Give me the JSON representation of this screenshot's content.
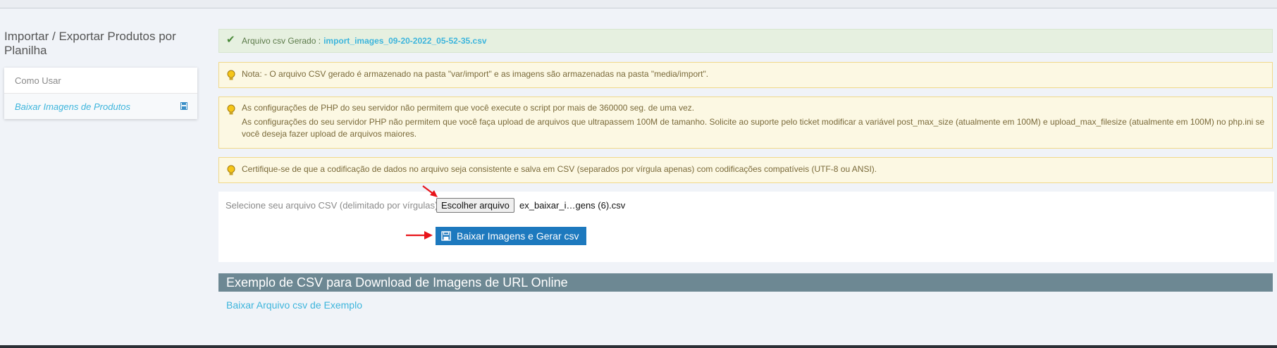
{
  "page": {
    "title": "Importar / Exportar Produtos por Planilha"
  },
  "sidebar": {
    "items": [
      {
        "label": "Como Usar",
        "active": false
      },
      {
        "label": "Baixar Imagens de Produtos",
        "active": true,
        "icon": "save-icon"
      }
    ]
  },
  "alerts": {
    "success": {
      "prefix": "Arquivo csv Gerado :",
      "filename": "import_images_09-20-2022_05-52-35.csv",
      "icon": "check-icon"
    },
    "note": "Nota: - O arquivo CSV gerado é armazenado na pasta \"var/import\" e as imagens são armazenadas na pasta \"media/import\".",
    "php_time": "As configurações de PHP do seu servidor não permitem que você execute o script por mais de 360000 seg. de uma vez.",
    "php_upload": "As configurações do seu servidor PHP não permitem que você faça upload de arquivos que ultrapassem 100M de tamanho. Solicite ao suporte pelo ticket modificar a variável post_max_size (atualmente em 100M) e upload_max_filesize (atualmente em 100M) no php.ini se você deseja fazer upload de arquivos maiores.",
    "encoding": "Certifique-se de que a codificação de dados no arquivo seja consistente e salva em CSV (separados por vírgula apenas) com codificações compatíveis (UTF-8 ou ANSI).",
    "warn_icon": "lightbulb-icon"
  },
  "form": {
    "csv_label": "Selecione seu arquivo CSV (delimitado por vírgulas)",
    "choose_button": "Escolher arquivo",
    "chosen_file": "ex_baixar_i…gens (6).csv",
    "submit_button": "Baixar Imagens e Gerar csv",
    "submit_icon": "save-icon"
  },
  "example": {
    "heading": "Exemplo de CSV para Download de Imagens de URL Online",
    "link": "Baixar Arquivo csv de Exemplo"
  },
  "colors": {
    "accent": "#3db5dc",
    "primary_button": "#1d79be",
    "section_header": "#6d8893",
    "annotation_arrow": "#e8141a"
  }
}
